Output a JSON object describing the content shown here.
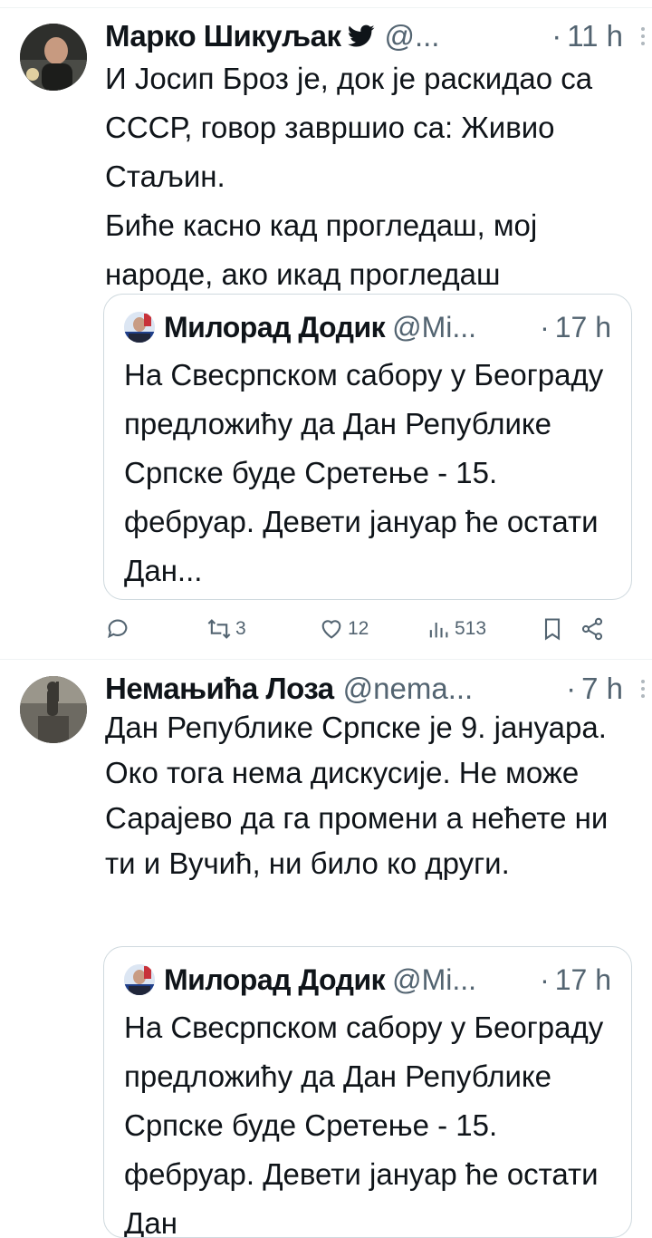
{
  "tweets": [
    {
      "author_name": "Марко Шикуљак",
      "handle": "@...",
      "separator": "·",
      "time": "11 h",
      "text_lines": [
        "И Јосип Броз је, док је раскидао са СССР, говор завршио са: Живио Стаљин.",
        "Биће касно кад прогледаш, мој народе, ако икад прогледаш"
      ],
      "quote": {
        "author_name": "Милорад Додик",
        "handle": "@Mi...",
        "separator": "·",
        "time": "17 h",
        "text": "На Свесрпском сабору у Београду предложићу да Дан Републике Српске буде Сретење - 15. фебруар. Девети јануар ће остати Дан..."
      },
      "actions": {
        "reply_icon": "reply-icon",
        "retweets": "3",
        "likes": "12",
        "views": "513",
        "bookmark_icon": "bookmark-icon",
        "share_icon": "share-icon"
      }
    },
    {
      "author_name": "Немањића Лоза",
      "handle": "@nema...",
      "separator": "·",
      "time": "7 h",
      "text_lines": [
        "Дан Републике Српске је 9. јануара. Око тога нема дискусије. Не може Сарајево да га промени а нећете ни ти и Вучић, ни било ко други."
      ],
      "quote": {
        "author_name": "Милорад Додик",
        "handle": "@Mi...",
        "separator": "·",
        "time": "17 h",
        "text": "На Свесрпском сабору у Београду предложићу да Дан Републике Српске буде Сретење - 15. фебруар. Девети јануар ће остати Дан"
      }
    }
  ],
  "colors": {
    "text": "#0f1419",
    "muted": "#536471",
    "verified": "#0f1419",
    "border": "#cfd9de"
  }
}
